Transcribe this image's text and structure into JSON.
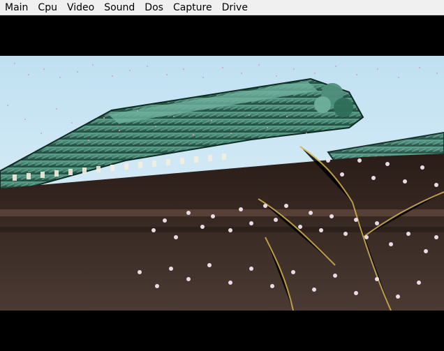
{
  "menubar": {
    "items": [
      {
        "label": "Main",
        "name": "menu-main"
      },
      {
        "label": "Cpu",
        "name": "menu-cpu"
      },
      {
        "label": "Video",
        "name": "menu-video"
      },
      {
        "label": "Sound",
        "name": "menu-sound"
      },
      {
        "label": "Dos",
        "name": "menu-dos"
      },
      {
        "label": "Capture",
        "name": "menu-capture"
      },
      {
        "label": "Drive",
        "name": "menu-drive"
      }
    ]
  },
  "scene": {
    "sky_color": "#cfe6f2",
    "roof_color": "#2f6f5a",
    "wall_color": "#3b2a22",
    "blossom_color": "#f1e4ee"
  }
}
